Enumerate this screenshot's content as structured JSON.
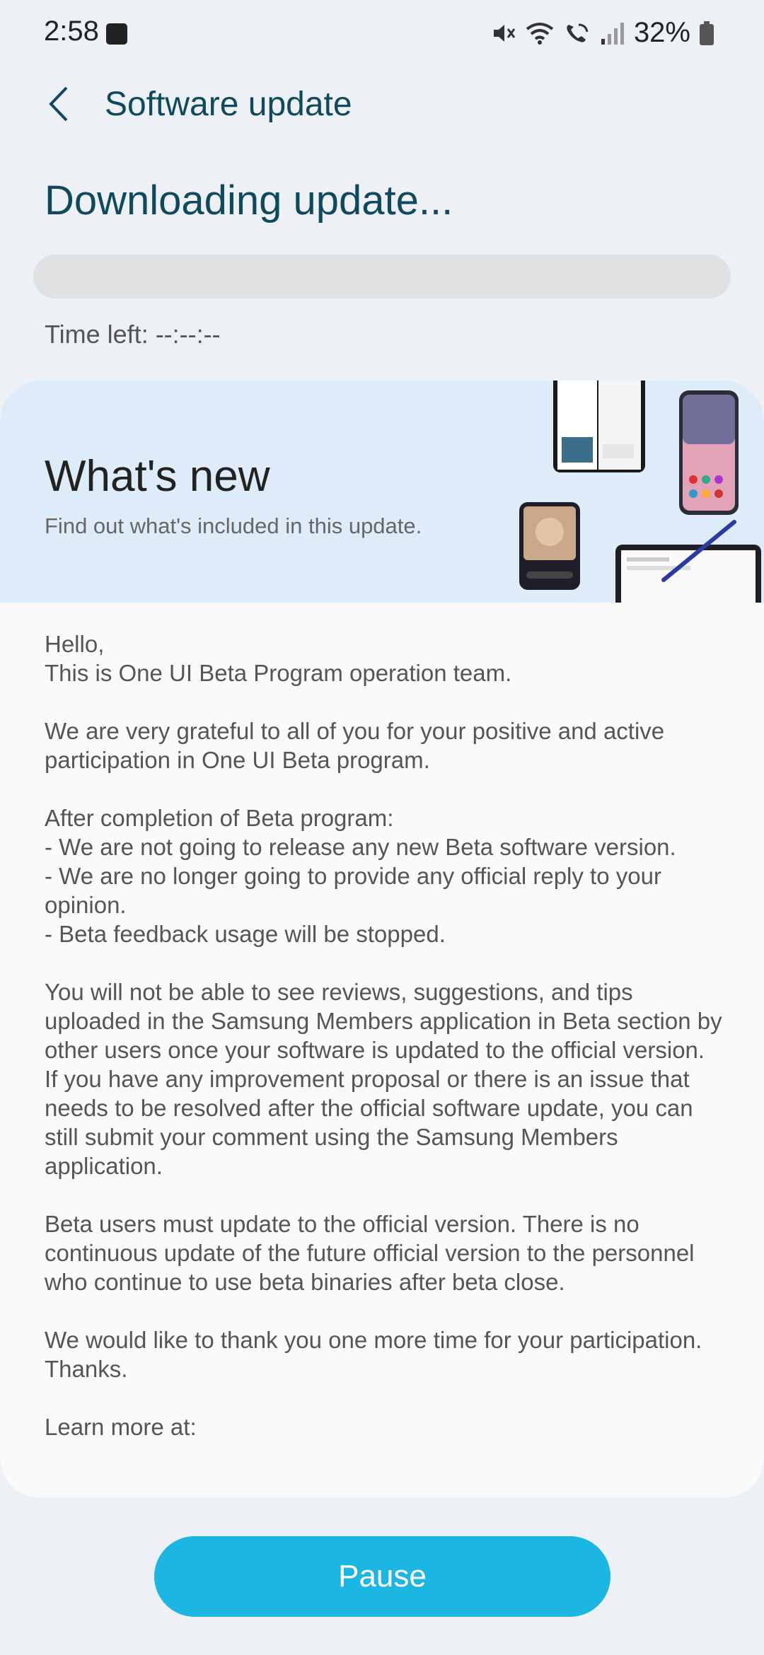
{
  "status_bar": {
    "time": "2:58",
    "battery_percent": "32%",
    "icons": [
      "mute-icon",
      "wifi-icon",
      "wifi-calling-icon",
      "signal-icon",
      "battery-icon"
    ]
  },
  "header": {
    "title": "Software update"
  },
  "download": {
    "title": "Downloading update...",
    "progress": 0,
    "time_left": "Time left: --:--:--"
  },
  "whats_new": {
    "title": "What's new",
    "subtitle": "Find out what's included in this update."
  },
  "release_notes": "Hello,\nThis is One UI Beta Program operation team.\n\nWe are very grateful to all of you for your positive and active participation in One UI Beta program.\n\nAfter completion of Beta program:\n- We are not going to release any new Beta software version.\n- We are no longer going to provide any official reply to your opinion.\n- Beta feedback usage will be stopped.\n\nYou will not be able to see reviews, suggestions, and tips uploaded in the Samsung Members application in Beta section by other users once your software is updated to the official version.\nIf you have any improvement proposal or there is an issue that needs to be resolved after the official software update, you can still submit your comment using the Samsung Members application.\n\nBeta users must update to the official version. There is no continuous update of the future official version to the personnel who continue to use beta binaries after beta close.\n\nWe would like to thank you one more time for your participation.\nThanks.\n\nLearn more at:",
  "actions": {
    "pause_label": "Pause"
  },
  "colors": {
    "accent": "#1bb6e1",
    "title_text": "#0f4a5c",
    "banner_bg": "#deecf9"
  }
}
